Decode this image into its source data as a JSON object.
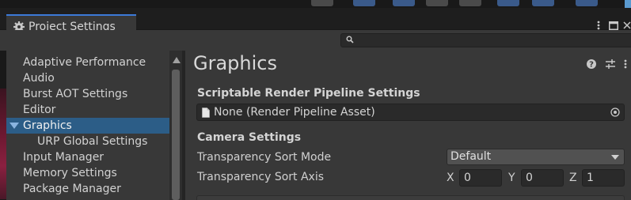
{
  "window": {
    "tab_title": "Project Settings",
    "menu_icon": "kebab-menu-icon",
    "maximize_icon": "maximize-icon",
    "close_icon": "close-icon"
  },
  "search": {
    "value": "",
    "placeholder": ""
  },
  "sidebar": {
    "items": [
      {
        "label": "Adaptive Performance"
      },
      {
        "label": "Audio"
      },
      {
        "label": "Burst AOT Settings"
      },
      {
        "label": "Editor"
      },
      {
        "label": "Graphics",
        "selected": true,
        "expanded": true
      },
      {
        "label": "URP Global Settings",
        "sub": true
      },
      {
        "label": "Input Manager"
      },
      {
        "label": "Memory Settings"
      },
      {
        "label": "Package Manager"
      }
    ]
  },
  "main": {
    "title": "Graphics",
    "header_icons": [
      "help-icon",
      "preset-icon",
      "kebab-menu-icon"
    ],
    "srp_section": "Scriptable Render Pipeline Settings",
    "srp_field_value": "None (Render Pipeline Asset)",
    "camera_section": "Camera Settings",
    "sort_mode_label": "Transparency Sort Mode",
    "sort_mode_value": "Default",
    "sort_axis_label": "Transparency Sort Axis",
    "axis": {
      "x_label": "X",
      "x_value": "0",
      "y_label": "Y",
      "y_value": "0",
      "z_label": "Z",
      "z_value": "1"
    }
  },
  "colors": {
    "selection": "#2c5d87",
    "tab_accent": "#3c7ad8",
    "panel": "#383838"
  }
}
